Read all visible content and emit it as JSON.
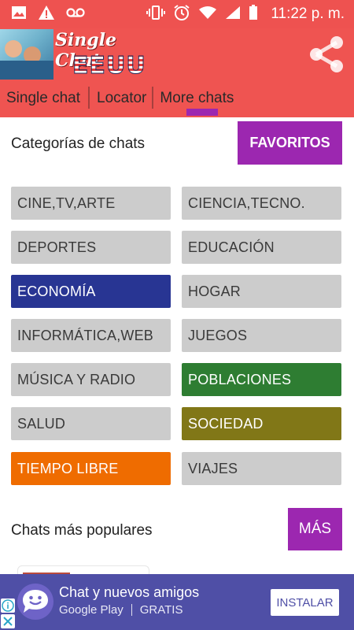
{
  "status_bar": {
    "time": "11:22 p. m.",
    "icons": [
      "image-icon",
      "warning-icon",
      "voicemail-icon",
      "vibrate-icon",
      "alarm-icon",
      "wifi-icon",
      "signal-icon",
      "battery-icon"
    ]
  },
  "app": {
    "title": "Single Chat",
    "subtitle": "EEUU",
    "share_icon": "share-icon"
  },
  "tabs": [
    {
      "label": "Single chat"
    },
    {
      "label": "Locator"
    },
    {
      "label": "More chats",
      "active": true
    }
  ],
  "categories_section": {
    "title": "Categorías de chats",
    "button": "FAVORITOS"
  },
  "categories": [
    {
      "label": "CINE,TV,ARTE",
      "color": "#cccccc"
    },
    {
      "label": "CIENCIA,TECNO.",
      "color": "#cccccc"
    },
    {
      "label": "DEPORTES",
      "color": "#cccccc"
    },
    {
      "label": "EDUCACIÓN",
      "color": "#cccccc"
    },
    {
      "label": "ECONOMÍA",
      "color": "#283593"
    },
    {
      "label": "HOGAR",
      "color": "#cccccc"
    },
    {
      "label": "INFORMÁTICA,WEB",
      "color": "#cccccc"
    },
    {
      "label": "JUEGOS",
      "color": "#cccccc"
    },
    {
      "label": "MÚSICA Y RADIO",
      "color": "#cccccc"
    },
    {
      "label": "POBLACIONES",
      "color": "#2e7d32"
    },
    {
      "label": "SALUD",
      "color": "#cccccc"
    },
    {
      "label": "SOCIEDAD",
      "color": "#817717"
    },
    {
      "label": "TIEMPO LIBRE",
      "color": "#ef6c00"
    },
    {
      "label": "VIAJES",
      "color": "#cccccc"
    }
  ],
  "popular_section": {
    "title": "Chats más populares",
    "button": "MÁS"
  },
  "ad": {
    "title": "Chat y nuevos amigos",
    "store": "Google Play",
    "price": "GRATIS",
    "button": "INSTALAR",
    "colors": {
      "background": "#4f4fa6"
    }
  },
  "colors": {
    "header": "#ef5451",
    "accent": "#9c27b0"
  }
}
